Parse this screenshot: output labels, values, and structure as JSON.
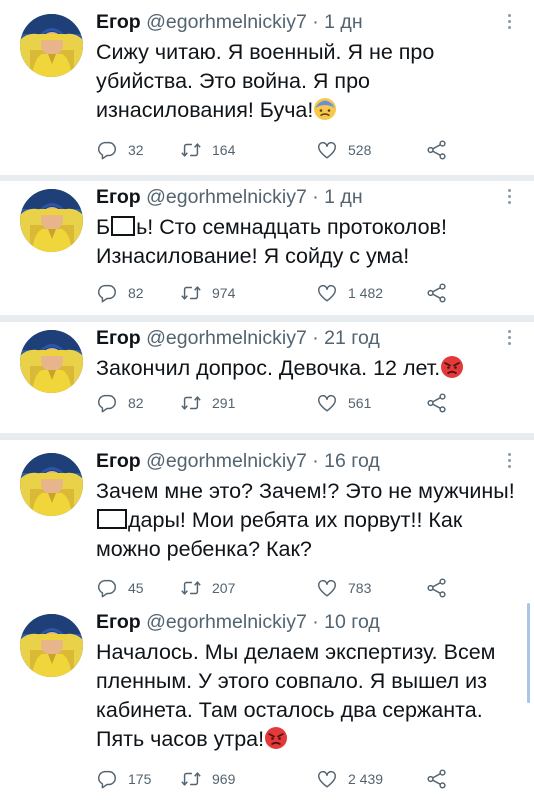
{
  "colors": {
    "text": "#0f1419",
    "secondary": "#536471",
    "separator": "#e6ecf0",
    "avatar_bg": "#e9d24a"
  },
  "tweets": [
    {
      "name": "Егор",
      "handle": "@egorhmelnickiy7",
      "sep": "·",
      "time": "1 дн",
      "text_parts": [
        "Сижу читаю. Я военный. Я не про убийства. Это война. Я про изнасилования! Буча!"
      ],
      "emoji": "anxious-sweat-face",
      "replies": "32",
      "retweets": "164",
      "likes": "528"
    },
    {
      "name": "Егор",
      "handle": "@egorhmelnickiy7",
      "sep": "·",
      "time": "1 дн",
      "text_parts": [
        "Б",
        "ь! Сто семнадцать протоколов! Изнасилование! Я сойду с ума!"
      ],
      "replies": "82",
      "retweets": "974",
      "likes": "1 482"
    },
    {
      "name": "Егор",
      "handle": "@egorhmelnickiy7",
      "sep": "·",
      "time": "21 год",
      "text_parts": [
        "Закончил допрос. Девочка. 12 лет."
      ],
      "emoji": "angry-face",
      "replies": "82",
      "retweets": "291",
      "likes": "561"
    },
    {
      "name": "Егор",
      "handle": "@egorhmelnickiy7",
      "sep": "·",
      "time": "16 год",
      "text_parts": [
        "Зачем мне это? Зачем!? Это не мужчины!",
        "дары! Мои ребята их порвут!! Как можно ребенка? Как?"
      ],
      "replies": "45",
      "retweets": "207",
      "likes": "783"
    },
    {
      "name": "Егор",
      "handle": "@egorhmelnickiy7",
      "sep": "·",
      "time": "10 год",
      "text_parts": [
        "Началось. Мы делаем экспертизу. Всем пленным. У этого совпало. Я вышел из кабинета. Там осталось два сержанта. Пять часов утра!"
      ],
      "emoji": "angry-face",
      "replies": "175",
      "retweets": "969",
      "likes": "2 439"
    }
  ]
}
